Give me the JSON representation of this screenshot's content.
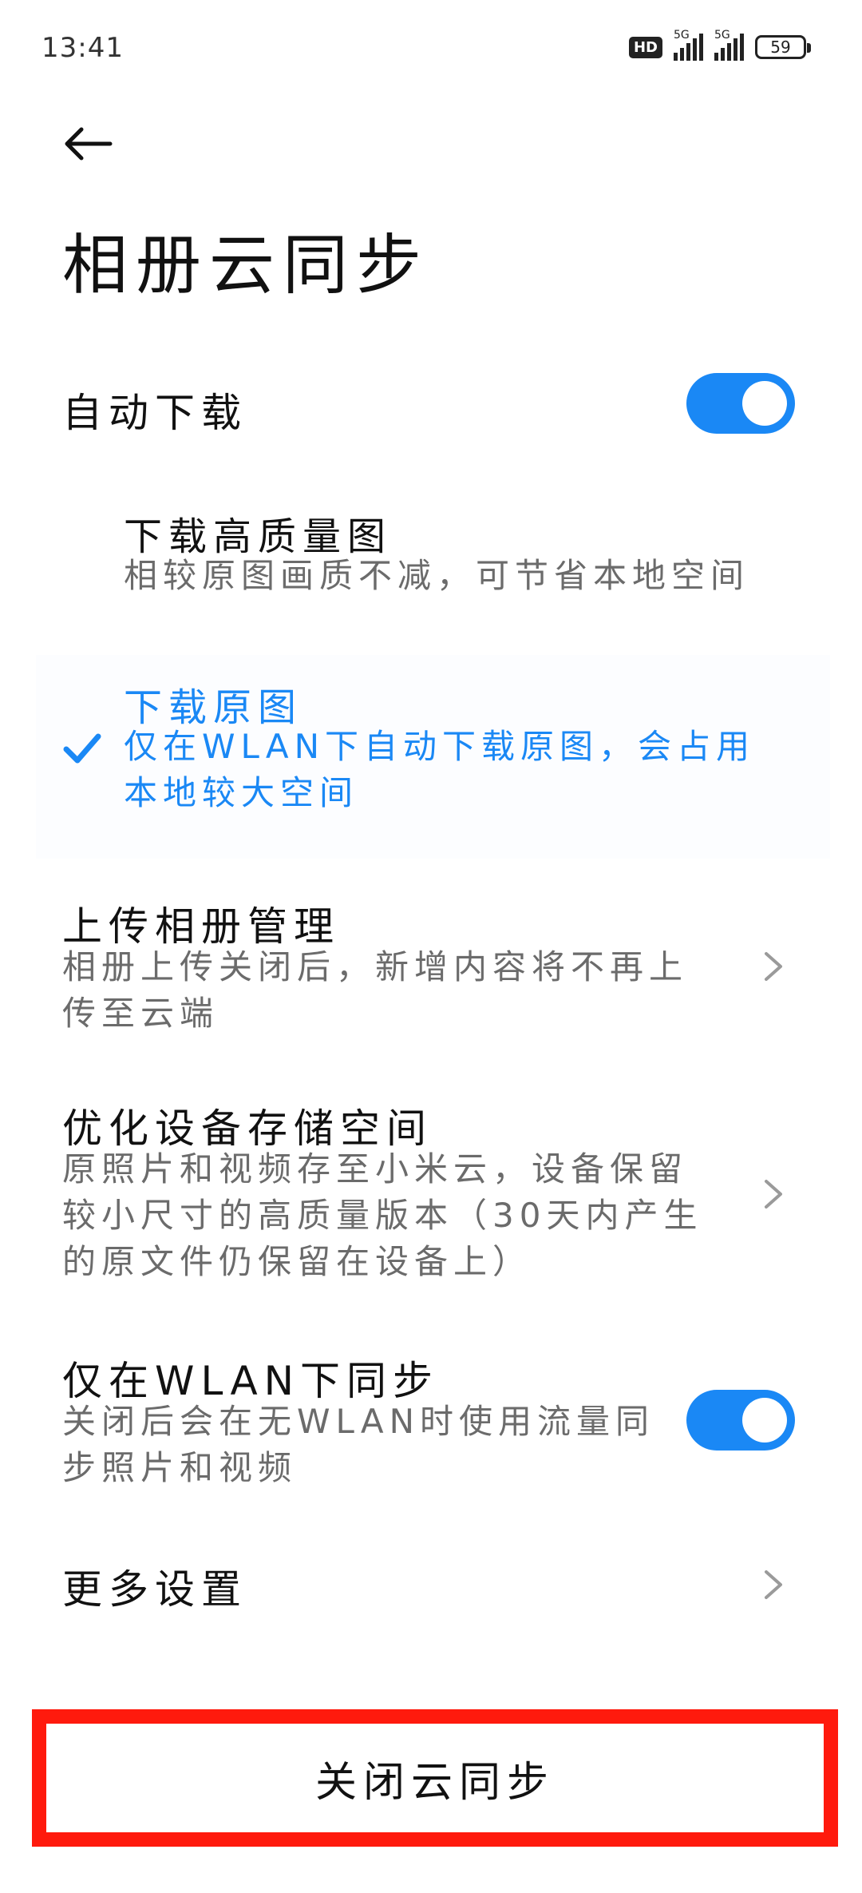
{
  "status_bar": {
    "time": "13:41",
    "hd": "HD",
    "sim1_network": "5G",
    "sim2_network": "5G",
    "battery": "59"
  },
  "header": {
    "back_icon": "arrow-left-icon",
    "title": "相册云同步"
  },
  "auto_download": {
    "label": "自动下载",
    "enabled": true
  },
  "download_options": {
    "high_quality": {
      "title": "下载高质量图",
      "desc": "相较原图画质不减，可节省本地空间",
      "selected": false
    },
    "original": {
      "title": "下载原图",
      "desc_line1": "仅在WLAN下自动下载原图，会占用",
      "desc_line2": "本地较大空间",
      "selected": true
    }
  },
  "upload_management": {
    "title": "上传相册管理",
    "desc_line1": "相册上传关闭后，新增内容将不再上",
    "desc_line2": "传至云端"
  },
  "optimize_storage": {
    "title": "优化设备存储空间",
    "desc_line1": "原照片和视频存至小米云，设备保留",
    "desc_line2": "较小尺寸的高质量版本（30天内产生",
    "desc_line3": "的原文件仍保留在设备上）"
  },
  "wlan_only": {
    "title": "仅在WLAN下同步",
    "desc_line1": "关闭后会在无WLAN时使用流量同",
    "desc_line2": "步照片和视频",
    "enabled": true
  },
  "more_settings": {
    "title": "更多设置"
  },
  "footer": {
    "close_sync_label": "关闭云同步"
  },
  "colors": {
    "accent": "#1a88f5",
    "highlight_border": "#ff1a0d",
    "secondary_text": "#6b6b6b"
  }
}
